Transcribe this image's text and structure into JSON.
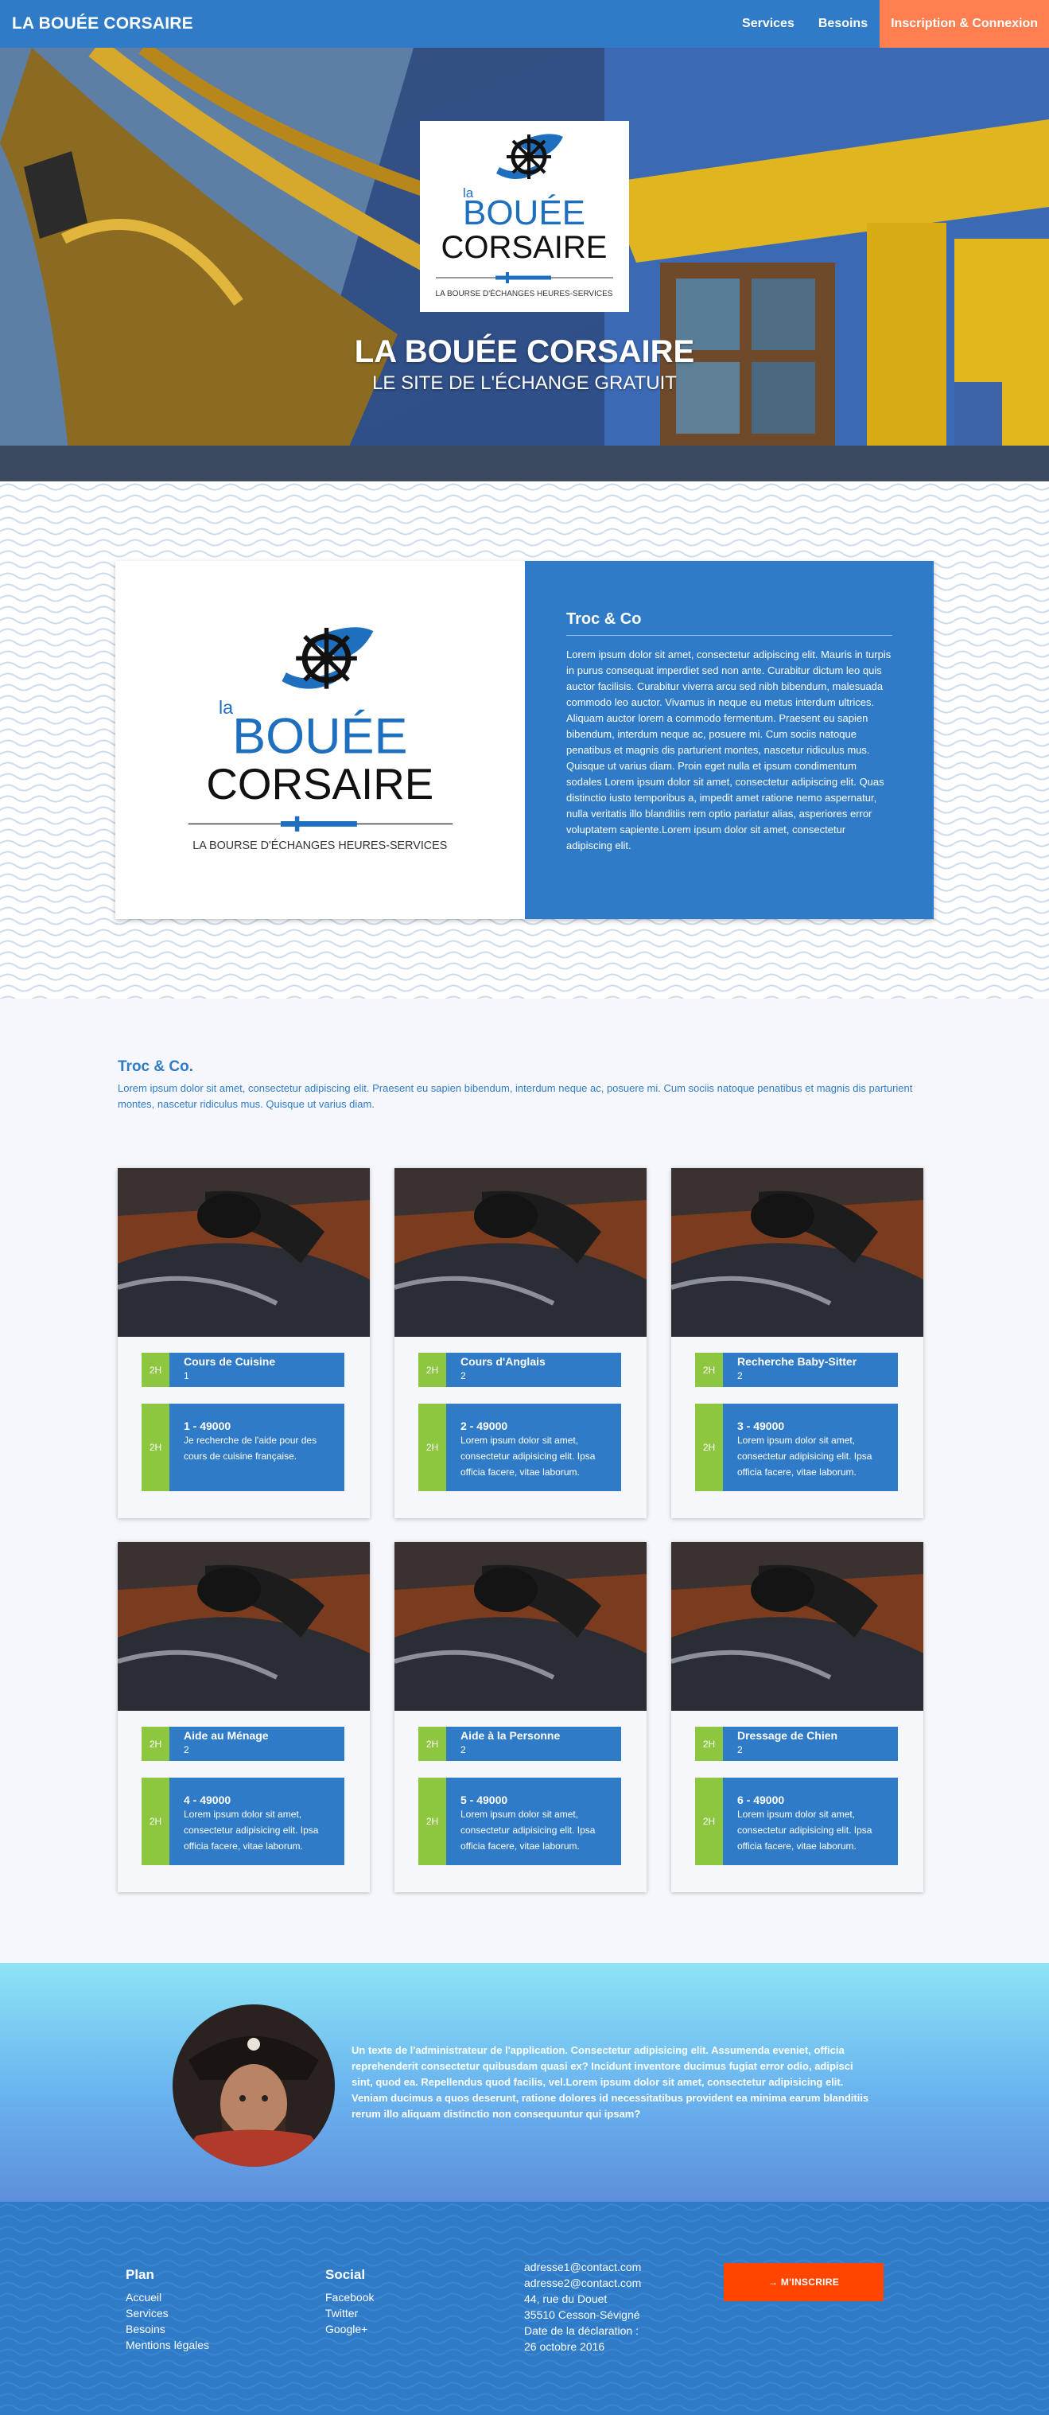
{
  "nav": {
    "brand": "LA BOUÉE CORSAIRE",
    "links": [
      "Services",
      "Besoins"
    ],
    "cta": "Inscription & Connexion"
  },
  "hero": {
    "title": "LA BOUÉE CORSAIRE",
    "subtitle": "LE SITE DE L'ÉCHANGE GRATUIT"
  },
  "logo": {
    "la": "la",
    "line1": "BOUÉE",
    "line2": "CORSAIRE",
    "tagline": "LA BOURSE D'ÉCHANGES HEURES-SERVICES"
  },
  "about": {
    "title": "Troc & Co",
    "text": "Lorem ipsum dolor sit amet, consectetur adipiscing elit. Mauris in turpis in purus consequat imperdiet sed non ante. Curabitur dictum leo quis auctor facilisis. Curabitur viverra arcu sed nibh bibendum, malesuada commodo leo auctor. Vivamus in neque eu metus interdum ultrices. Aliquam auctor lorem a commodo fermentum. Praesent eu sapien bibendum, interdum neque ac, posuere mi. Cum sociis natoque penatibus et magnis dis parturient montes, nascetur ridiculus mus. Quisque ut varius diam. Proin eget nulla et ipsum condimentum sodales Lorem ipsum dolor sit amet, consectetur adipiscing elit. Quas distinctio iusto temporibus a, impedit amet ratione nemo aspernatur, nulla veritatis illo blanditiis rem optio pariatur alias, asperiores error voluptatem sapiente.Lorem ipsum dolor sit amet, consectetur adipiscing elit."
  },
  "services": {
    "title": "Troc & Co.",
    "intro": "Lorem ipsum dolor sit amet, consectetur adipiscing elit. Praesent eu sapien bibendum, interdum neque ac, posuere mi. Cum sociis natoque penatibus et magnis dis parturient montes, nascetur ridiculus mus. Quisque ut varius diam.",
    "cards": [
      {
        "badge": "2H",
        "name": "Cours de Cuisine",
        "count": "1",
        "ref": "1 - 49000",
        "desc": "Je recherche de l'aide pour des cours de cuisine française."
      },
      {
        "badge": "2H",
        "name": "Cours d'Anglais",
        "count": "2",
        "ref": "2 - 49000",
        "desc": "Lorem ipsum dolor sit amet, consectetur adipisicing elit. Ipsa officia facere, vitae laborum."
      },
      {
        "badge": "2H",
        "name": "Recherche Baby-Sitter",
        "count": "2",
        "ref": "3 - 49000",
        "desc": "Lorem ipsum dolor sit amet, consectetur adipisicing elit. Ipsa officia facere, vitae laborum."
      },
      {
        "badge": "2H",
        "name": "Aide au Ménage",
        "count": "2",
        "ref": "4 - 49000",
        "desc": "Lorem ipsum dolor sit amet, consectetur adipisicing elit. Ipsa officia facere, vitae laborum."
      },
      {
        "badge": "2H",
        "name": "Aide à la Personne",
        "count": "2",
        "ref": "5 - 49000",
        "desc": "Lorem ipsum dolor sit amet, consectetur adipisicing elit. Ipsa officia facere, vitae laborum."
      },
      {
        "badge": "2H",
        "name": "Dressage de Chien",
        "count": "2",
        "ref": "6 - 49000",
        "desc": "Lorem ipsum dolor sit amet, consectetur adipisicing elit. Ipsa officia facere, vitae laborum."
      }
    ]
  },
  "testimonial": {
    "text": "Un texte de l'administrateur de l'application. Consectetur adipisicing elit. Assumenda eveniet, officia reprehenderit consectetur quibusdam quasi ex? Incidunt inventore ducimus fugiat error odio, adipisci sint, quod ea. Repellendus quod facilis, vel.Lorem ipsum dolor sit amet, consectetur adipisicing elit. Veniam ducimus a quos deserunt, ratione dolores id necessitatibus provident ea minima earum blanditiis rerum illo aliquam distinctio non consequuntur qui ipsam?"
  },
  "footer": {
    "plan_title": "Plan",
    "plan_links": [
      "Accueil",
      "Services",
      "Besoins",
      "Mentions légales"
    ],
    "social_title": "Social",
    "social_links": [
      "Facebook",
      "Twitter",
      "Google+"
    ],
    "contact_lines": [
      "adresse1@contact.com",
      "adresse2@contact.com",
      "44, rue du Douet",
      "35510 Cesson-Sévigné",
      "Date de la déclaration :",
      "26 octobre 2016"
    ],
    "cta": "→ M'INSCRIRE"
  },
  "colors": {
    "brand_blue": "#2f7bc7",
    "accent_orange": "#ff7f50",
    "cta_red": "#ff4500",
    "badge_green": "#8dc63f"
  }
}
